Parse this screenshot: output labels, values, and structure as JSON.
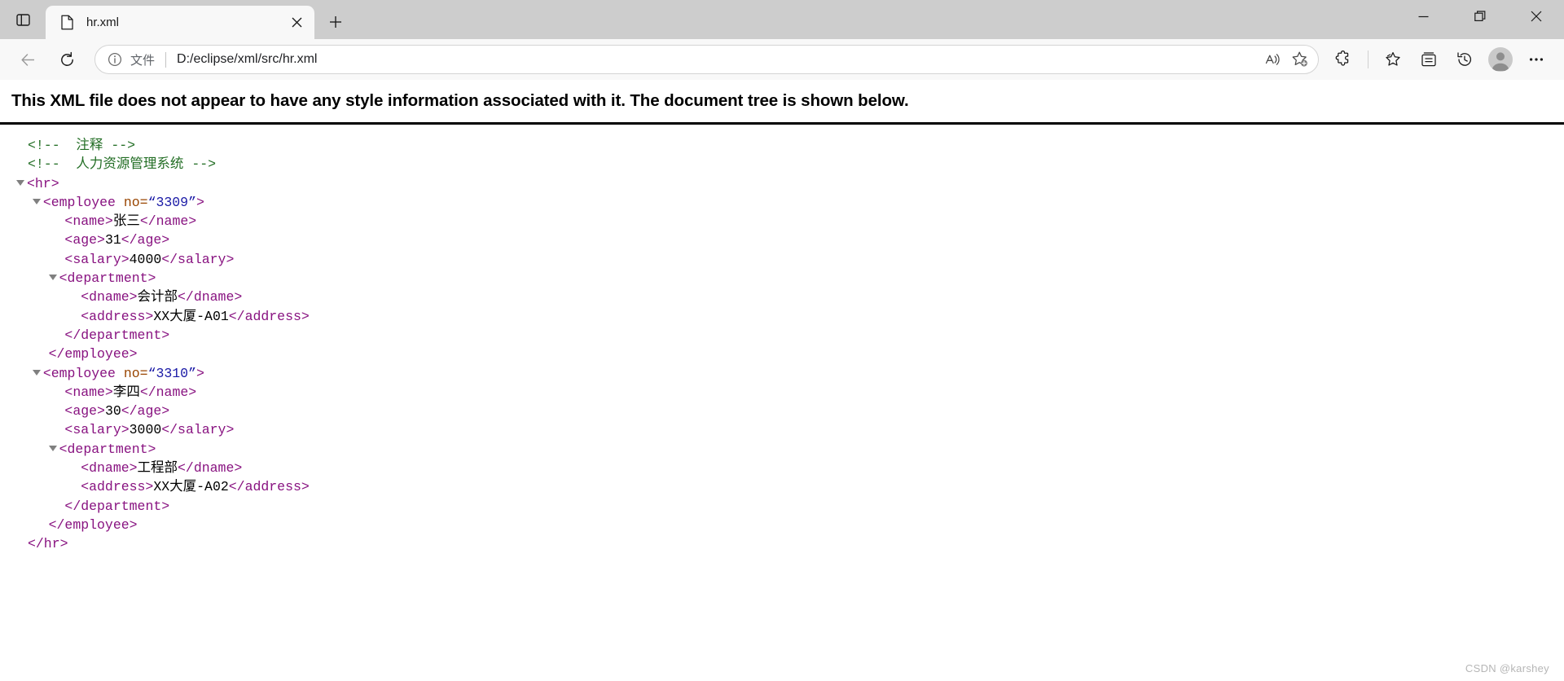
{
  "window": {
    "controls": {
      "minimize_label": "Minimize",
      "restore_label": "Restore",
      "close_label": "Close"
    }
  },
  "tabstrip": {
    "tab_search_label": "Tab actions menu",
    "new_tab_label": "New tab",
    "tabs": [
      {
        "title": "hr.xml",
        "favicon": "file-icon",
        "close_label": "Close tab",
        "active": true
      }
    ]
  },
  "toolbar": {
    "back_label": "Back",
    "refresh_label": "Refresh",
    "omnibox": {
      "info_icon": "info-icon",
      "scheme_label": "文件",
      "url": "D:/eclipse/xml/src/hr.xml",
      "read_aloud_label": "Read this page aloud",
      "favorite_label": "Add this page to favorites"
    },
    "extensions_label": "Extensions",
    "favorites_label": "Favorites",
    "collections_label": "Collections",
    "history_label": "History",
    "profile_label": "Profile",
    "settings_label": "Settings and more"
  },
  "page": {
    "notice": "This XML file does not appear to have any style information associated with it. The document tree is shown below.",
    "watermark": "CSDN @karshey",
    "xml": {
      "comments": [
        {
          "open": "<!--",
          "body": "  注释 ",
          "close": "-->"
        },
        {
          "open": "<!--",
          "body": "  人力资源管理系统 ",
          "close": "-->"
        }
      ],
      "root_open": "<hr>",
      "root_close": "</hr>",
      "employees": [
        {
          "open_prefix": "<employee ",
          "attr_name": "no",
          "attr_eq": "=",
          "attr_value": "“3309”",
          "open_suffix": ">",
          "close": "</employee>",
          "fields": [
            {
              "open": "<name>",
              "value": "张三",
              "close": "</name>"
            },
            {
              "open": "<age>",
              "value": "31",
              "close": "</age>"
            },
            {
              "open": "<salary>",
              "value": "4000",
              "close": "</salary>"
            }
          ],
          "department": {
            "open": "<department>",
            "close": "</department>",
            "fields": [
              {
                "open": "<dname>",
                "value": "会计部",
                "close": "</dname>"
              },
              {
                "open": "<address>",
                "value": "XX大厦-A01",
                "close": "</address>"
              }
            ]
          }
        },
        {
          "open_prefix": "<employee ",
          "attr_name": "no",
          "attr_eq": "=",
          "attr_value": "“3310”",
          "open_suffix": ">",
          "close": "</employee>",
          "fields": [
            {
              "open": "<name>",
              "value": "李四",
              "close": "</name>"
            },
            {
              "open": "<age>",
              "value": "30",
              "close": "</age>"
            },
            {
              "open": "<salary>",
              "value": "3000",
              "close": "</salary>"
            }
          ],
          "department": {
            "open": "<department>",
            "close": "</department>",
            "fields": [
              {
                "open": "<dname>",
                "value": "工程部",
                "close": "</dname>"
              },
              {
                "open": "<address>",
                "value": "XX大厦-A02",
                "close": "</address>"
              }
            ]
          }
        }
      ]
    }
  },
  "colors": {
    "tag": "#881280",
    "attr_name": "#994500",
    "attr_value": "#1a1aa6",
    "comment": "#236e25",
    "titlebar_bg": "#cdcdcd",
    "toolbar_bg": "#f8f8f8",
    "tab_bg": "#f8f8f8"
  }
}
